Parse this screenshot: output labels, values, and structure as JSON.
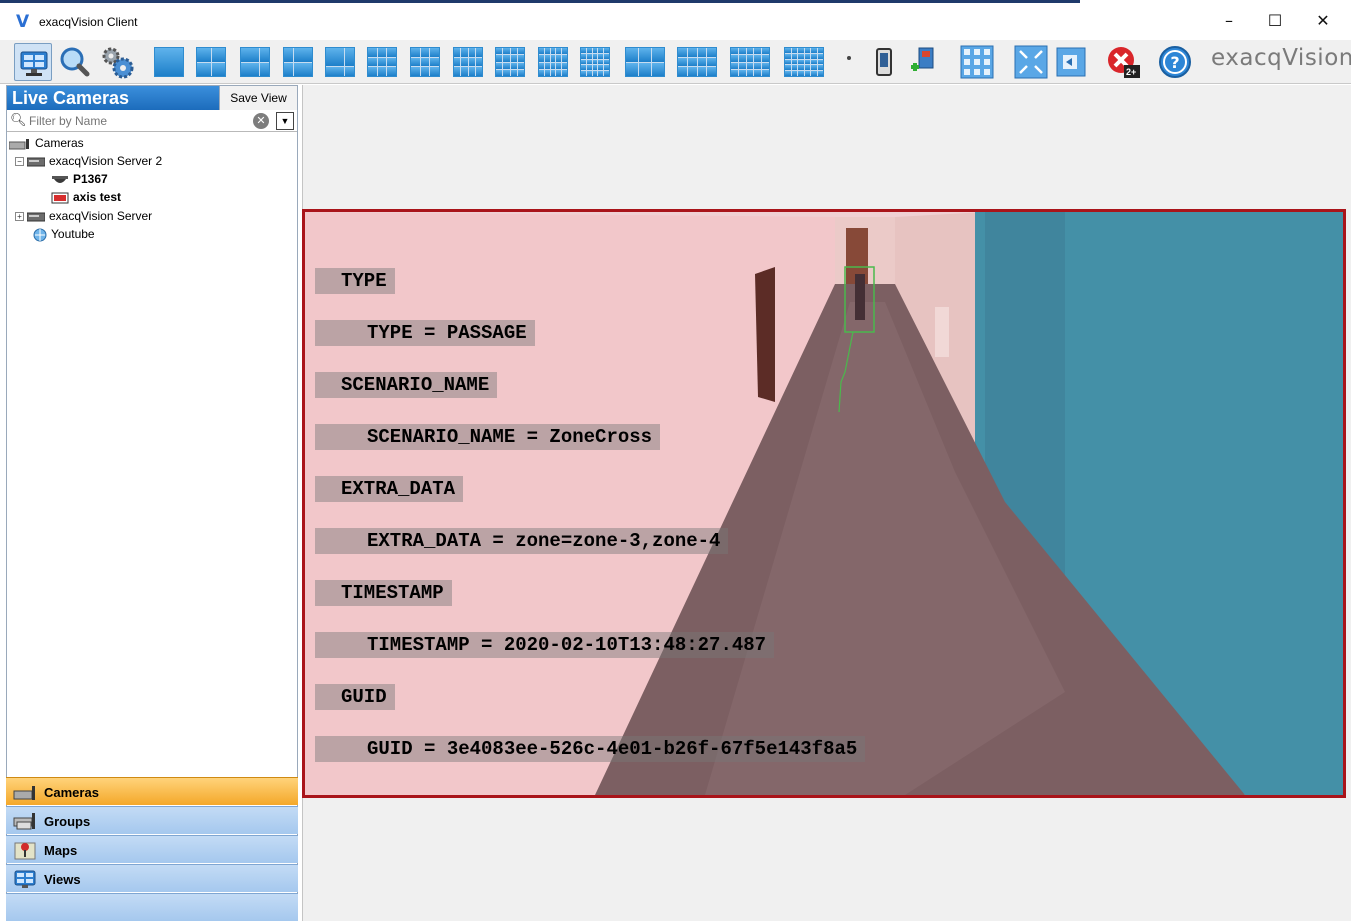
{
  "window": {
    "title": "exacqVision Client",
    "logo_glyph": "V",
    "minimize": "–",
    "maximize": "☐",
    "close": "✕"
  },
  "toolbar": {
    "brand": "exacqVision",
    "buttons": [
      "live-view-icon",
      "search-icon",
      "config-gear-icon",
      "layout-1x1",
      "layout-2x2",
      "layout-1plus5",
      "layout-1plus7",
      "layout-1plus12",
      "layout-3x3",
      "layout-2plus8",
      "layout-1plus9",
      "layout-4x4",
      "layout-4x5",
      "layout-5x5",
      "layout-2x3",
      "layout-3x4",
      "layout-4x6",
      "layout-5x6",
      "more-layouts",
      "phone-icon",
      "add-camera-icon",
      "grid-panel-icon",
      "fullscreen-icon",
      "exit-icon",
      "alarm-icon",
      "help-icon"
    ],
    "alarm_count": "2+"
  },
  "left_panel": {
    "title": "Live Cameras",
    "save_view": "Save View",
    "filter_placeholder": "Filter by Name",
    "tree": {
      "root": "Cameras",
      "server2": "exacqVision Server 2",
      "cam1": "P1367",
      "cam2": "axis test",
      "server1": "exacqVision Server",
      "youtube": "Youtube"
    }
  },
  "nav": {
    "cameras": "Cameras",
    "groups": "Groups",
    "maps": "Maps",
    "views": "Views"
  },
  "overlay": {
    "l1": "TYPE",
    "l2": "TYPE = PASSAGE",
    "l3": "SCENARIO_NAME",
    "l4": "SCENARIO_NAME = ZoneCross",
    "l5": "EXTRA_DATA",
    "l6": "EXTRA_DATA = zone=zone-3,zone-4",
    "l7": "TIMESTAMP",
    "l8": "TIMESTAMP = 2020-02-10T13:48:27.487",
    "l9": "GUID",
    "l10": "GUID = 3e4083ee-526c-4e01-b26f-67f5e143f8a5"
  },
  "colors": {
    "selection_border": "#a9141a",
    "header_blue": "#1c6cbc",
    "nav_active": "#f4a82a",
    "wall_teal": "#2e9ab0"
  }
}
